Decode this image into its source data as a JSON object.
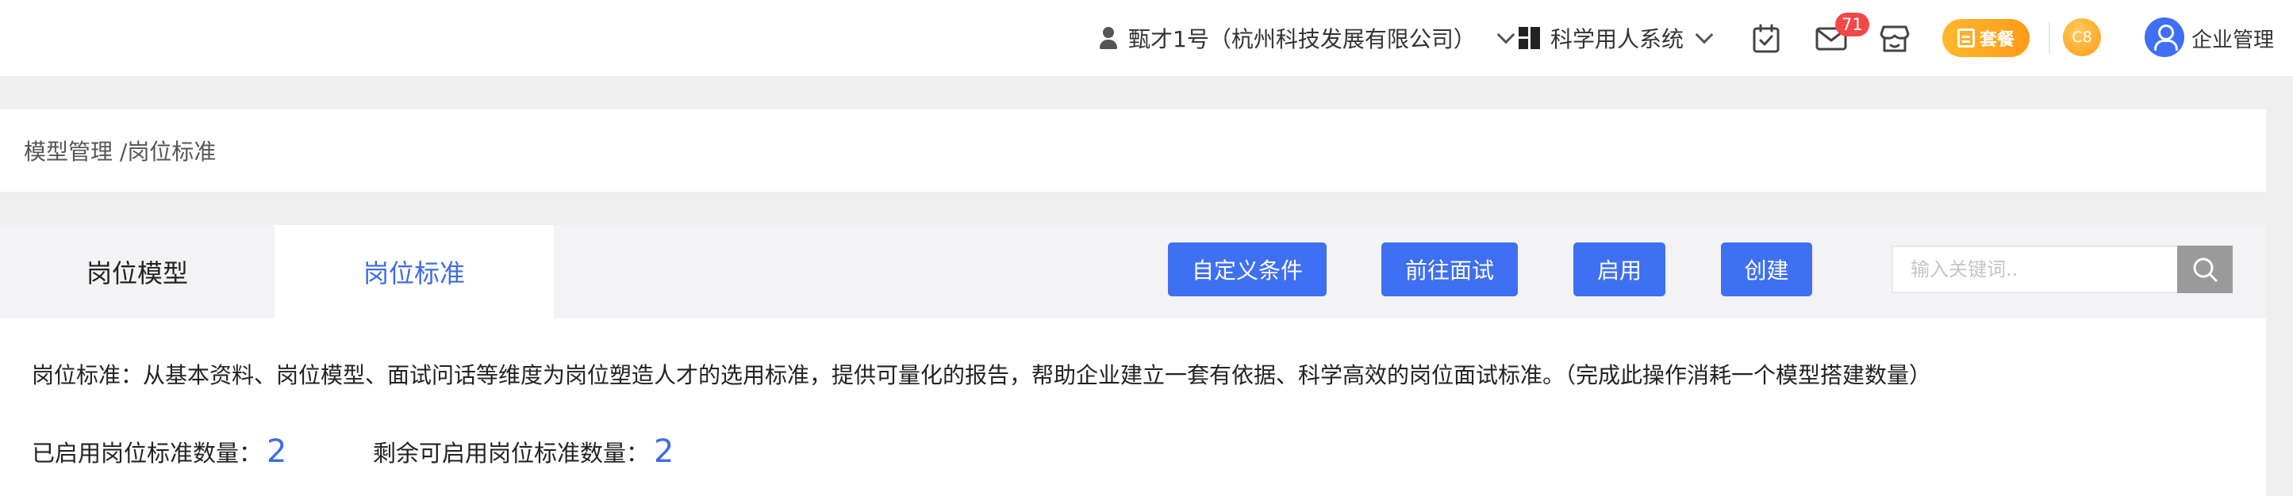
{
  "header": {
    "company": "甄才1号（杭州科技发展有限公司）",
    "system": "科学用人系统",
    "mail_count": "71",
    "package_label": "套餐",
    "coin_label": "C8",
    "account_label": "企业管理"
  },
  "breadcrumb": {
    "path": "模型管理 /岗位标准"
  },
  "tabs": [
    {
      "label": "岗位模型",
      "active": false
    },
    {
      "label": "岗位标准",
      "active": true
    }
  ],
  "toolbar": {
    "custom_conditions": "自定义条件",
    "go_interview": "前往面试",
    "enable": "启用",
    "create": "创建",
    "search_placeholder": "输入关键词.."
  },
  "content": {
    "description": "岗位标准：从基本资料、岗位模型、面试问话等维度为岗位塑造人才的选用标准，提供可量化的报告，帮助企业建立一套有依据、科学高效的岗位面试标准。（完成此操作消耗一个模型搭建数量）",
    "enabled_label": "已启用岗位标准数量：",
    "enabled_value": "2",
    "remaining_label": "剩余可启用岗位标准数量：",
    "remaining_value": "2"
  },
  "colors": {
    "primary": "#3f6ff2",
    "badge": "#f24848",
    "package": "#ff9a16"
  }
}
